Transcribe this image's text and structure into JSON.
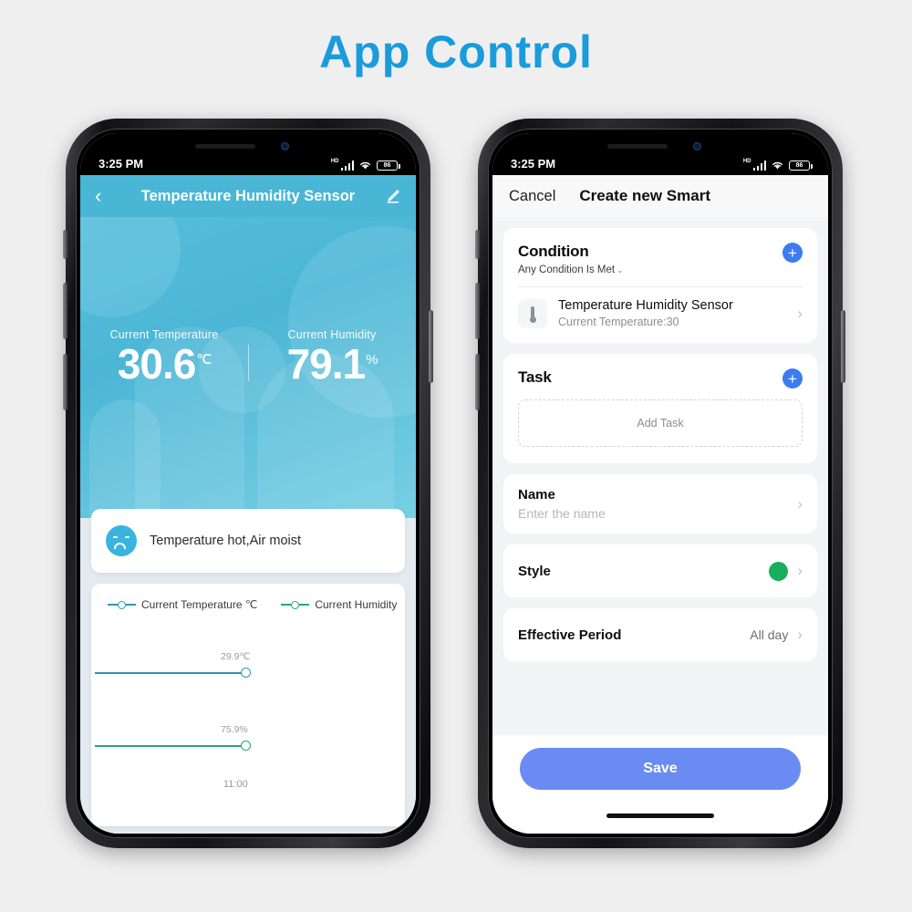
{
  "banner": {
    "title": "App Control",
    "color": "#1a9bdc"
  },
  "status_bar": {
    "time": "3:25 PM",
    "network_label": "HD",
    "battery_level": "86",
    "icons": [
      "hd-signal-icon",
      "wifi-icon",
      "battery-icon"
    ]
  },
  "phone1": {
    "header": {
      "back": "‹",
      "title": "Temperature Humidity Sensor",
      "edit_icon": "edit-pencil-icon"
    },
    "readings": [
      {
        "label": "Current Temperature",
        "value": "30.6",
        "unit": "℃"
      },
      {
        "label": "Current Humidity",
        "value": "79.1",
        "unit": "%"
      }
    ],
    "status_card": {
      "icon": "sad-face-icon",
      "text": "Temperature hot,Air moist"
    },
    "chart": {
      "legend": [
        {
          "label": "Current Temperature ℃",
          "color": "#2a9ab5"
        },
        {
          "label": "Current Humidity",
          "color": "#27a57e"
        }
      ],
      "temperature_tag": "29.9℃",
      "humidity_tag": "75.9%",
      "x_tick": "11:00"
    }
  },
  "chart_data": {
    "type": "line",
    "title": "",
    "xlabel": "",
    "ylabel": "",
    "x": [
      "11:00"
    ],
    "series": [
      {
        "name": "Current Temperature ℃",
        "values": [
          29.9
        ],
        "color": "#2a9ab5",
        "label": "29.9℃"
      },
      {
        "name": "Current Humidity",
        "values": [
          75.9
        ],
        "color": "#27a57e",
        "label": "75.9%"
      }
    ],
    "legend_position": "top-left",
    "grid": false
  },
  "phone2": {
    "header": {
      "cancel": "Cancel",
      "title": "Create new Smart"
    },
    "condition": {
      "title": "Condition",
      "subtitle": "Any Condition Is Met",
      "caret": "⌄",
      "add_icon": "plus-circle-icon",
      "item": {
        "icon": "thermometer-icon",
        "name": "Temperature Humidity Sensor",
        "detail": "Current Temperature:30",
        "chevron": "›"
      }
    },
    "task": {
      "title": "Task",
      "add_icon": "plus-circle-icon",
      "placeholder": "Add Task"
    },
    "rows": [
      {
        "title": "Name",
        "sub": "Enter the name",
        "value": "",
        "chevron": "›",
        "swatch": null
      },
      {
        "title": "Style",
        "sub": "",
        "value": "",
        "chevron": "›",
        "swatch": "#19ae5c"
      },
      {
        "title": "Effective Period",
        "sub": "",
        "value": "All day",
        "chevron": "›",
        "swatch": null
      }
    ],
    "save_label": "Save",
    "save_color": "#6a8cf2"
  }
}
